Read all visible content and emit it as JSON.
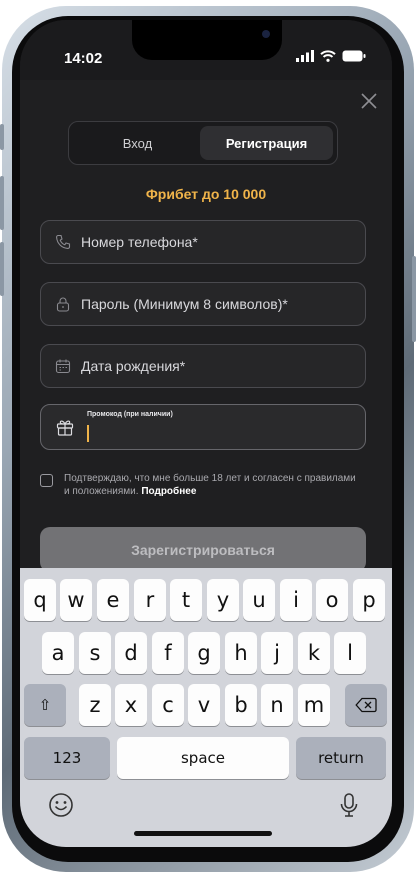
{
  "status": {
    "time": "14:02"
  },
  "tabs": {
    "login": "Вход",
    "register": "Регистрация"
  },
  "promo_banner": "Фрибет до 10 000",
  "form": {
    "phone_placeholder": "Номер телефона*",
    "password_placeholder": "Пароль (Минимум 8 символов)*",
    "birthdate_placeholder": "Дата рождения*",
    "promo_label": "Промокод (при наличии)",
    "promo_value": ""
  },
  "agreement": {
    "text": "Подтверждаю, что мне больше 18 лет и согласен с правилами и положениями.",
    "link": "Подробнее"
  },
  "submit_label": "Зарегистрироваться",
  "keyboard": {
    "row1": [
      "q",
      "w",
      "e",
      "r",
      "t",
      "y",
      "u",
      "i",
      "o",
      "p"
    ],
    "row2": [
      "a",
      "s",
      "d",
      "f",
      "g",
      "h",
      "j",
      "k",
      "l"
    ],
    "row3": [
      "z",
      "x",
      "c",
      "v",
      "b",
      "n",
      "m"
    ],
    "shift": "⇧",
    "numbers": "123",
    "space": "space",
    "return": "return"
  },
  "colors": {
    "accent": "#f0b44a",
    "background": "#1f1f21",
    "button_disabled": "#727275"
  }
}
